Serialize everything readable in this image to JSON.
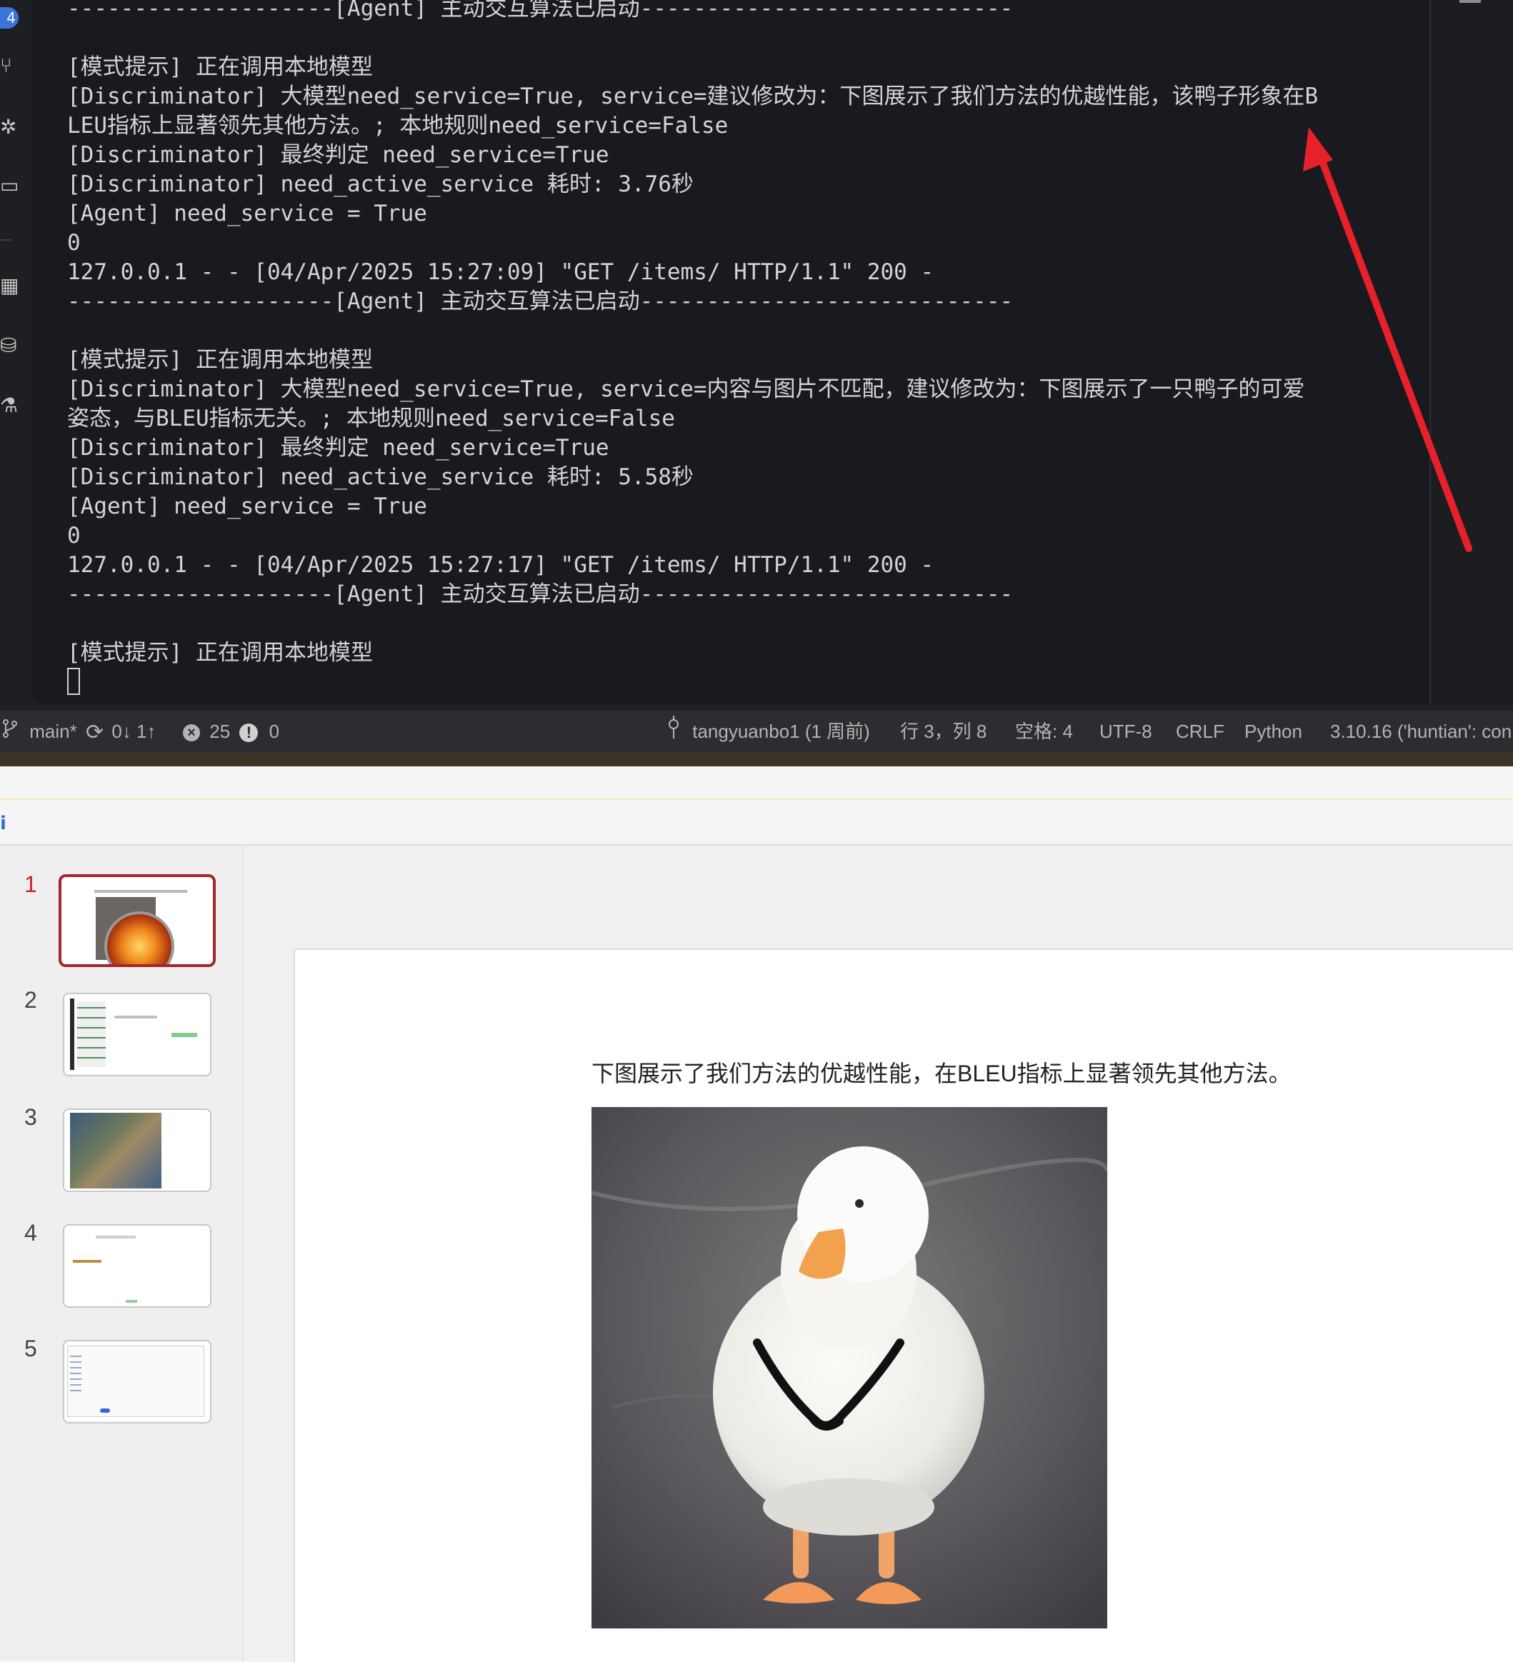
{
  "activity_bar": {
    "badge": "4"
  },
  "terminal": {
    "lines": [
      "--------------------[Agent] 主动交互算法已启动----------------------------",
      "",
      "[模式提示] 正在调用本地模型",
      "[Discriminator] 大模型need_service=True, service=建议修改为：下图展示了我们方法的优越性能，该鸭子形象在B",
      "LEU指标上显著领先其他方法。; 本地规则need_service=False",
      "[Discriminator] 最终判定 need_service=True",
      "[Discriminator] need_active_service 耗时: 3.76秒",
      "[Agent] need_service = True",
      "0",
      "127.0.0.1 - - [04/Apr/2025 15:27:09] \"GET /items/ HTTP/1.1\" 200 -",
      "--------------------[Agent] 主动交互算法已启动----------------------------",
      "",
      "[模式提示] 正在调用本地模型",
      "[Discriminator] 大模型need_service=True, service=内容与图片不匹配，建议修改为：下图展示了一只鸭子的可爱",
      "姿态，与BLEU指标无关。; 本地规则need_service=False",
      "[Discriminator] 最终判定 need_service=True",
      "[Discriminator] need_active_service 耗时: 5.58秒",
      "[Agent] need_service = True",
      "0",
      "127.0.0.1 - - [04/Apr/2025 15:27:17] \"GET /items/ HTTP/1.1\" 200 -",
      "--------------------[Agent] 主动交互算法已启动----------------------------",
      "",
      "[模式提示] 正在调用本地模型"
    ]
  },
  "annotation": {
    "color": "#e8202a"
  },
  "status_bar": {
    "branch": "main*",
    "sync": "0↓ 1↑",
    "errors": "25",
    "warnings": "0",
    "blame": "tangyuanbo1 (1 周前)",
    "position": "行 3，列 8",
    "indent": "空格: 4",
    "encoding": "UTF-8",
    "eol": "CRLF",
    "language": "Python",
    "interpreter": "3.10.16 ('huntian': con"
  },
  "slides": {
    "thumbnails": [
      {
        "number": "1",
        "selected": true
      },
      {
        "number": "2",
        "selected": false
      },
      {
        "number": "3",
        "selected": false
      },
      {
        "number": "4",
        "selected": false
      },
      {
        "number": "5",
        "selected": false
      }
    ],
    "current": {
      "caption": "下图展示了我们方法的优越性能，在BLEU指标上显著领先其他方法。"
    }
  },
  "colors": {
    "terminal_bg": "#181a1f",
    "status_bg": "#2b2d30",
    "selected_thumb_border": "#a4262c",
    "accent_blue": "#3c74d9"
  }
}
